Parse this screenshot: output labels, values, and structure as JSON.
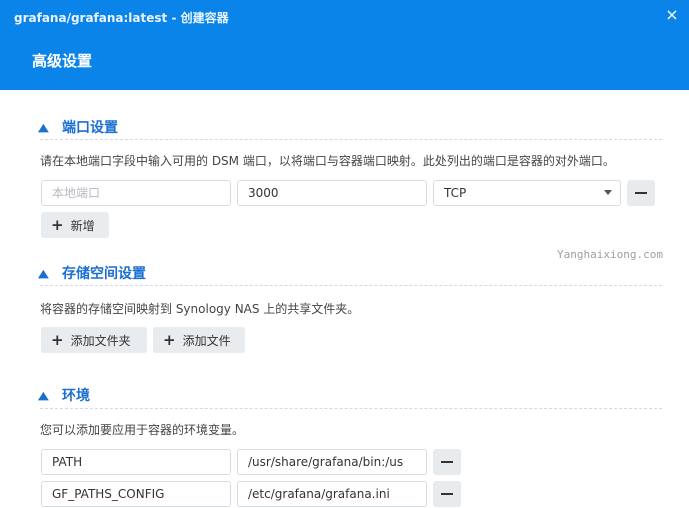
{
  "window": {
    "title": "grafana/grafana:latest - 创建容器",
    "close_icon": "×"
  },
  "header": {
    "title": "高级设置"
  },
  "port_section": {
    "title": "端口设置",
    "description": "请在本地端口字段中输入可用的 DSM 端口，以将端口与容器端口映射。此处列出的端口是容器的对外端口。",
    "row": {
      "local_port_placeholder": "本地端口",
      "container_port": "3000",
      "protocol": "TCP"
    },
    "add_label": "新增"
  },
  "storage_section": {
    "title": "存储空间设置",
    "description": "将容器的存储空间映射到 Synology NAS 上的共享文件夹。",
    "add_folder_label": "添加文件夹",
    "add_file_label": "添加文件"
  },
  "env_section": {
    "title": "环境",
    "description": "您可以添加要应用于容器的环境变量。",
    "rows": [
      {
        "name": "PATH",
        "value": "/usr/share/grafana/bin:/us"
      },
      {
        "name": "GF_PATHS_CONFIG",
        "value": "/etc/grafana/grafana.ini"
      }
    ]
  },
  "watermark": "Yanghaixiong.com",
  "colors": {
    "header": "#0a84e8",
    "accent": "#1a6fd1"
  }
}
